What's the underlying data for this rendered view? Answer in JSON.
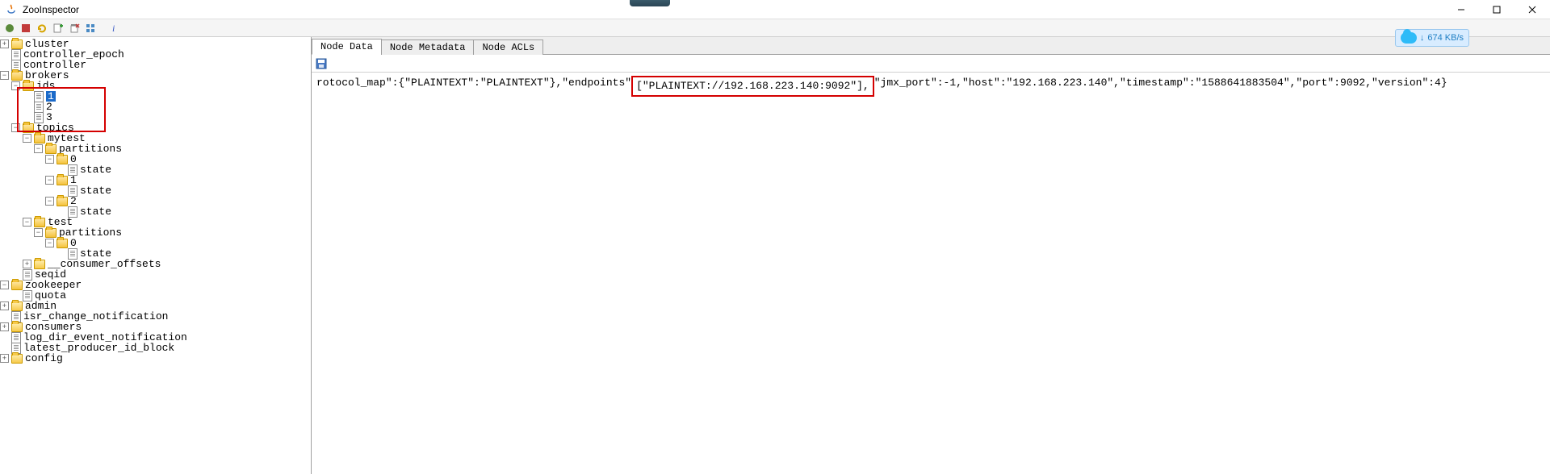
{
  "window": {
    "title": "ZooInspector"
  },
  "download": {
    "speed": "674 KB/s",
    "arrow": "↓"
  },
  "tabs": {
    "nodeData": "Node Data",
    "nodeMetadata": "Node Metadata",
    "nodeACLs": "Node ACLs"
  },
  "nodeData": {
    "part1": "rotocol_map\":{\"PLAINTEXT\":\"PLAINTEXT\"},\"endpoints\"",
    "part2_highlight": "[\"PLAINTEXT://192.168.223.140:9092\"],",
    "part3": "\"jmx_port\":-1,\"host\":\"192.168.223.140\",\"timestamp\":\"1588641883504\",\"port\":9092,\"version\":4}"
  },
  "tree": {
    "cluster": "cluster",
    "controller_epoch": "controller_epoch",
    "controller": "controller",
    "brokers": "brokers",
    "ids": "ids",
    "id1": "1",
    "id2": "2",
    "id3": "3",
    "topics": "topics",
    "mytest": "mytest",
    "partitions": "partitions",
    "p0": "0",
    "p1": "1",
    "p2": "2",
    "state": "state",
    "test": "test",
    "consumer_offsets": "__consumer_offsets",
    "seqid": "seqid",
    "zookeeper": "zookeeper",
    "quota": "quota",
    "admin": "admin",
    "isr_change": "isr_change_notification",
    "consumers": "consumers",
    "log_dir": "log_dir_event_notification",
    "latest_producer": "latest_producer_id_block",
    "config": "config"
  }
}
